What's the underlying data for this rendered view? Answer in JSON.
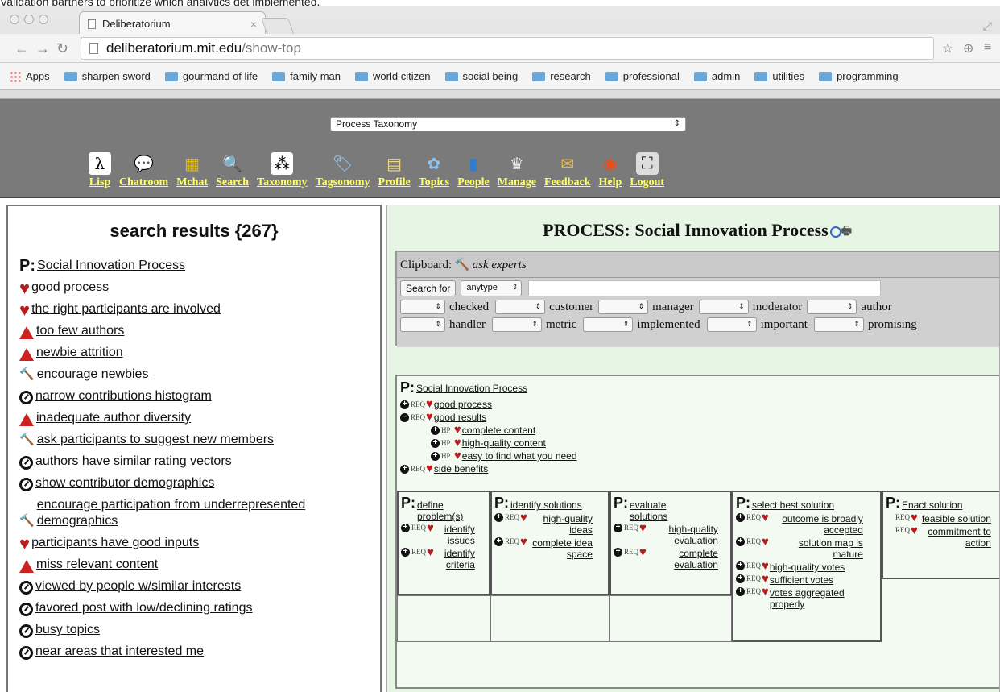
{
  "caption": "Validation partners to prioritize which analytics get implemented.",
  "browser": {
    "tab_title": "Deliberatorium",
    "tab_close": "×",
    "url_host": "deliberatorium.mit.edu",
    "url_path": "/show-top",
    "bookmarks": [
      "Apps",
      "sharpen sword",
      "gourmand of life",
      "family man",
      "world citizen",
      "social being",
      "research",
      "professional",
      "admin",
      "utilities",
      "programming"
    ]
  },
  "app": {
    "top_select": "Process Taxonomy",
    "tools": [
      {
        "label": "Lisp",
        "icon": "λ",
        "name": "lisp"
      },
      {
        "label": "Chatroom",
        "icon": "💬",
        "name": "chatroom"
      },
      {
        "label": "Mchat",
        "icon": "▦",
        "name": "mchat"
      },
      {
        "label": "Search",
        "icon": "🔍",
        "name": "search"
      },
      {
        "label": "Taxonomy",
        "icon": "⁂",
        "name": "taxonomy"
      },
      {
        "label": "Tagsonomy",
        "icon": "🏷",
        "name": "tagsonomy"
      },
      {
        "label": "Profile",
        "icon": "▤",
        "name": "profile"
      },
      {
        "label": "Topics",
        "icon": "✿",
        "name": "topics"
      },
      {
        "label": "People",
        "icon": "▮",
        "name": "people"
      },
      {
        "label": "Manage",
        "icon": "♛",
        "name": "manage"
      },
      {
        "label": "Feedback",
        "icon": "✉",
        "name": "feedback"
      },
      {
        "label": "Help",
        "icon": "◉",
        "name": "help"
      },
      {
        "label": "Logout",
        "icon": "⛶",
        "name": "logout"
      }
    ]
  },
  "left": {
    "title": "search results {267}",
    "results": [
      {
        "type": "process",
        "prefix": "P:",
        "text": "Social Innovation Process"
      },
      {
        "type": "goal",
        "text": "good process"
      },
      {
        "type": "goal",
        "text": "the right participants are involved"
      },
      {
        "type": "problem",
        "text": "too few authors"
      },
      {
        "type": "problem",
        "text": "newbie attrition"
      },
      {
        "type": "solution",
        "text": "encourage newbies"
      },
      {
        "type": "metric",
        "text": "narrow contributions histogram"
      },
      {
        "type": "problem",
        "text": "inadequate author diversity"
      },
      {
        "type": "solution",
        "text": "ask participants to suggest new members"
      },
      {
        "type": "metric",
        "text": "authors have similar rating vectors"
      },
      {
        "type": "metric",
        "text": "show contributor demographics"
      },
      {
        "type": "solution",
        "text": "encourage participation from underrepresented demographics"
      },
      {
        "type": "goal",
        "text": "participants have good inputs"
      },
      {
        "type": "problem",
        "text": "miss relevant content"
      },
      {
        "type": "metric",
        "text": "viewed by people w/similar interests"
      },
      {
        "type": "metric",
        "text": "favored post with low/declining ratings"
      },
      {
        "type": "metric",
        "text": "busy topics"
      },
      {
        "type": "metric",
        "text": "near areas that interested me"
      }
    ]
  },
  "right": {
    "title": "PROCESS: Social Innovation Process",
    "clipboard_label": "Clipboard:",
    "clipboard_item": "ask experts",
    "search_button": "Search for",
    "type_select": "anytype",
    "filters_row1": [
      "checked",
      "customer",
      "manager",
      "moderator",
      "author"
    ],
    "filters_row2": [
      "handler",
      "metric",
      "implemented",
      "important",
      "promising"
    ],
    "tree_root": "Social Innovation Process",
    "req": "REQ",
    "hp": "HP",
    "tree_items": {
      "good_process": "good process",
      "good_results": "good results",
      "complete_content": "complete content",
      "high_quality_content": "high-quality content",
      "easy_to_find": "easy to find what you need",
      "side_benefits": "side benefits"
    },
    "columns": [
      {
        "title": "define problem(s)",
        "items": [
          "identify issues",
          "identify criteria"
        ]
      },
      {
        "title": "identify solutions",
        "items": [
          "high-quality ideas",
          "complete idea space"
        ]
      },
      {
        "title": "evaluate solutions",
        "items": [
          "high-quality evaluation",
          "complete evaluation"
        ]
      },
      {
        "title": "select best solution",
        "items": [
          "outcome is broadly accepted",
          "solution map is mature",
          "high-quality votes",
          "sufficient votes",
          "votes aggregated properly"
        ]
      },
      {
        "title": "Enact solution",
        "items": [
          "feasible solution",
          "commitment to action"
        ]
      }
    ]
  }
}
